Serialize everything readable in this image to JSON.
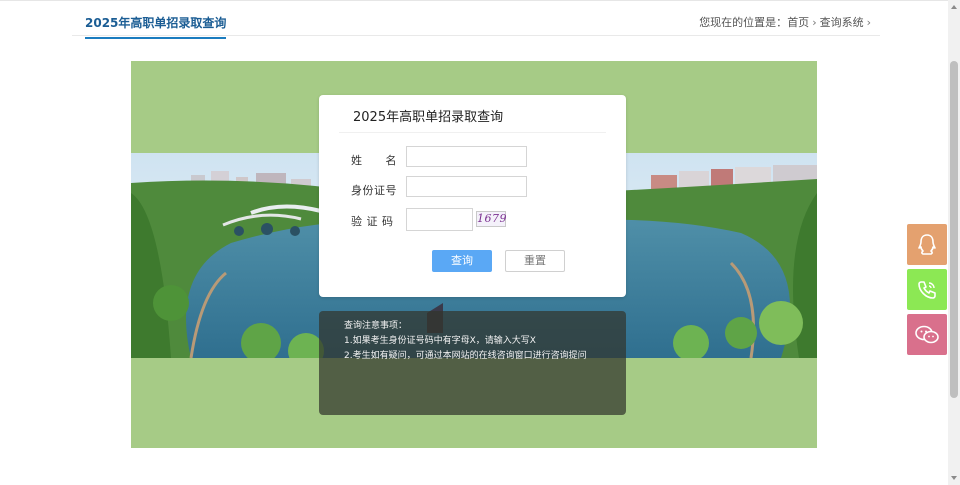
{
  "header": {
    "title": "2025年高职单招录取查询",
    "breadcrumb": {
      "prefix": "您现在的位置是：",
      "items": [
        "首页",
        "查询系统"
      ],
      "separator": "›"
    }
  },
  "form": {
    "title": "2025年高职单招录取查询",
    "name_label": "姓　　名",
    "name_value": "",
    "id_label": "身份证号",
    "id_value": "",
    "captcha_label": "验 证 码",
    "captcha_value": "",
    "captcha_image_text": "1679",
    "submit_label": "查询",
    "reset_label": "重置"
  },
  "notice": {
    "title": "查询注意事项：",
    "lines": [
      "1.如果考生身份证号码中有字母X，请输入大写X",
      "2.考生如有疑问，可通过本网站的在线咨询窗口进行咨询提问"
    ]
  },
  "side_buttons": [
    {
      "name": "qq",
      "color": "#e4a16f"
    },
    {
      "name": "phone",
      "color": "#8ce854"
    },
    {
      "name": "wechat",
      "color": "#d9708c"
    }
  ],
  "colors": {
    "accent": "#1b7cbf",
    "banner_bg": "#a6cb86",
    "query_button": "#5aa8f5"
  }
}
